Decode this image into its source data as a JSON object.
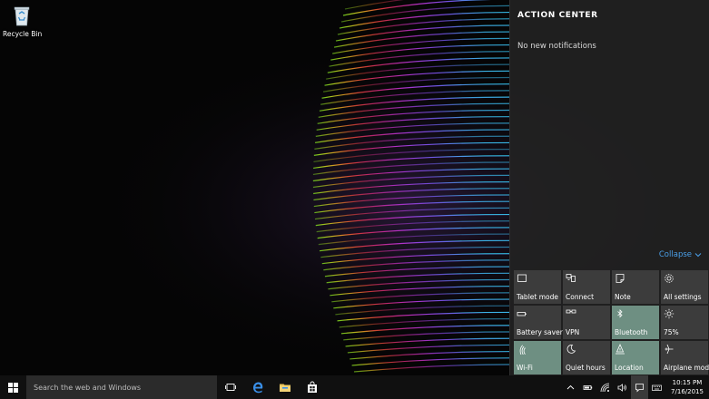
{
  "desktop": {
    "icons": [
      {
        "label": "Recycle Bin",
        "icon": "recycle-bin-icon"
      }
    ]
  },
  "action_center": {
    "title": "ACTION CENTER",
    "empty_message": "No new notifications",
    "collapse_label": "Collapse",
    "accent_color": "#4a9fe8",
    "quick_actions": [
      {
        "label": "Tablet mode",
        "icon": "tablet-icon",
        "active": false
      },
      {
        "label": "Connect",
        "icon": "connect-icon",
        "active": false
      },
      {
        "label": "Note",
        "icon": "note-icon",
        "active": false
      },
      {
        "label": "All settings",
        "icon": "gear-icon",
        "active": false
      },
      {
        "label": "Battery saver",
        "icon": "battery-icon",
        "active": false
      },
      {
        "label": "VPN",
        "icon": "vpn-icon",
        "active": false
      },
      {
        "label": "Bluetooth",
        "icon": "bluetooth-icon",
        "active": true
      },
      {
        "label": "75%",
        "icon": "brightness-icon",
        "active": false
      },
      {
        "label": "Wi-Fi",
        "icon": "wifi-icon",
        "active": true
      },
      {
        "label": "Quiet hours",
        "icon": "moon-icon",
        "active": false
      },
      {
        "label": "Location",
        "icon": "location-icon",
        "active": true
      },
      {
        "label": "Airplane mode",
        "icon": "airplane-icon",
        "active": false
      }
    ],
    "active_tile_color": "#6e8f82"
  },
  "taskbar": {
    "search_placeholder": "Search the web and Windows",
    "pinned": [
      "task-view-icon",
      "edge-icon",
      "file-explorer-icon",
      "store-icon"
    ],
    "tray": [
      "chevron-up-icon",
      "battery-tray-icon",
      "wifi-tray-icon",
      "volume-icon",
      "action-center-icon",
      "keyboard-icon"
    ],
    "time": "10:15 PM",
    "date": "7/16/2015"
  }
}
